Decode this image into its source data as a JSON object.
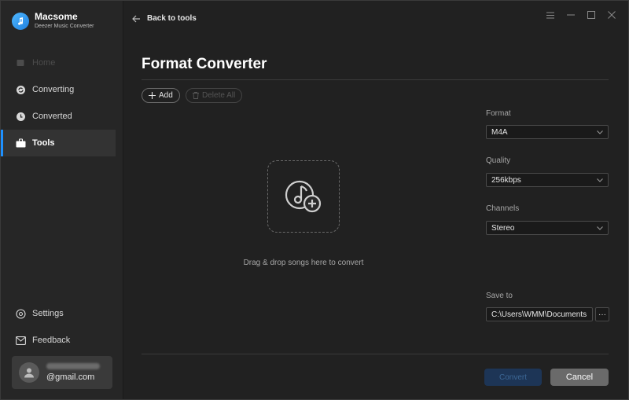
{
  "brand": {
    "name": "Macsome",
    "subtitle": "Deezer Music Converter",
    "icon": "music-note-logo-icon"
  },
  "sidebar": {
    "items": [
      {
        "label": "Home",
        "icon": "home-icon",
        "state": "disabled"
      },
      {
        "label": "Converting",
        "icon": "converting-icon",
        "state": "normal"
      },
      {
        "label": "Converted",
        "icon": "clock-icon",
        "state": "normal"
      },
      {
        "label": "Tools",
        "icon": "toolbox-icon",
        "state": "active"
      }
    ],
    "bottom_items": [
      {
        "label": "Settings",
        "icon": "gear-icon"
      },
      {
        "label": "Feedback",
        "icon": "mail-icon"
      }
    ],
    "account": {
      "email": "@gmail.com",
      "icon": "user-avatar-icon"
    }
  },
  "header": {
    "back_label": "Back to tools",
    "window_controls": [
      "menu-icon",
      "minimize-icon",
      "maximize-icon",
      "close-icon"
    ]
  },
  "main": {
    "title": "Format Converter",
    "toolbar": {
      "add_label": "Add",
      "delete_all_label": "Delete All"
    },
    "dropzone": {
      "text": "Drag & drop songs here to convert",
      "icon": "music-add-icon"
    },
    "settings": {
      "format": {
        "label": "Format",
        "value": "M4A"
      },
      "quality": {
        "label": "Quality",
        "value": "256kbps"
      },
      "channels": {
        "label": "Channels",
        "value": "Stereo"
      },
      "save_to": {
        "label": "Save to",
        "value": "C:\\Users\\WMM\\Documents",
        "browse_label": "···"
      }
    },
    "actions": {
      "convert_label": "Convert",
      "cancel_label": "Cancel"
    }
  },
  "colors": {
    "accent": "#1e90ff",
    "background": "#212121",
    "sidebar": "#262626"
  }
}
